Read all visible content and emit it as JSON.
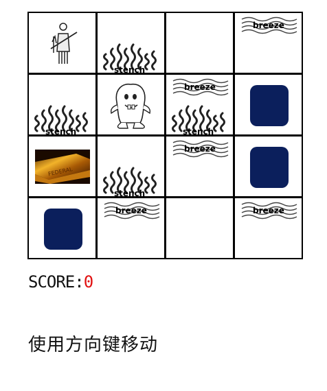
{
  "board": {
    "rows": 4,
    "cols": 4,
    "cells": [
      [
        {
          "items": [
            "hunter-icon"
          ]
        },
        {
          "items": [
            "stench"
          ]
        },
        {
          "items": []
        },
        {
          "items": [
            "breeze"
          ]
        }
      ],
      [
        {
          "items": [
            "stench"
          ]
        },
        {
          "items": [
            "wumpus-icon"
          ]
        },
        {
          "items": [
            "breeze",
            "stench"
          ]
        },
        {
          "items": [
            "pit-icon"
          ]
        }
      ],
      [
        {
          "items": [
            "gold-icon"
          ]
        },
        {
          "items": [
            "stench"
          ]
        },
        {
          "items": [
            "breeze"
          ]
        },
        {
          "items": [
            "pit-icon"
          ]
        }
      ],
      [
        {
          "items": [
            "pit-icon"
          ]
        },
        {
          "items": [
            "breeze"
          ]
        },
        {
          "items": []
        },
        {
          "items": [
            "breeze"
          ]
        }
      ]
    ]
  },
  "labels": {
    "stench": "stench",
    "breeze": "breeze"
  },
  "score": {
    "label": "SCORE:",
    "value": "0"
  },
  "hint": "使用方向键移动",
  "colors": {
    "pit": "#0b1f5c",
    "score_value": "#e11111"
  }
}
